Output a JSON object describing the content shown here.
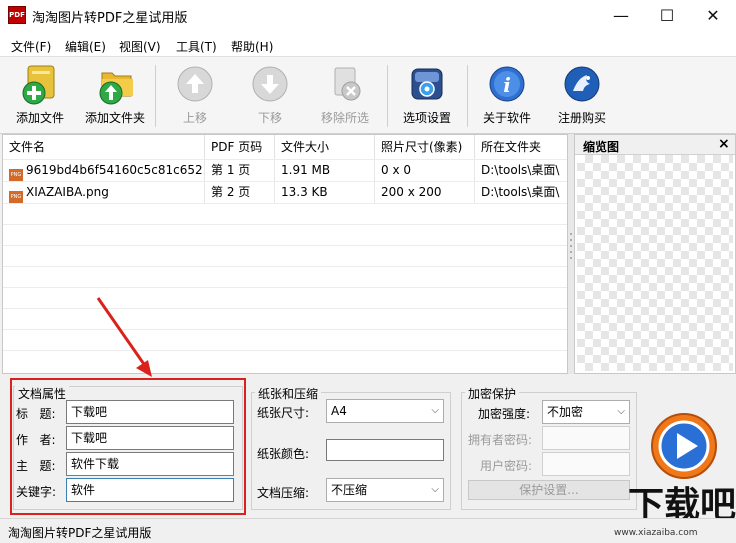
{
  "window": {
    "title": "淘淘图片转PDF之星试用版",
    "app_icon": "PDF",
    "controls": {
      "minimize": "—",
      "maximize": "☐",
      "close": "✕"
    }
  },
  "menu": [
    "文件(F)",
    "编辑(E)",
    "视图(V)",
    "工具(T)",
    "帮助(H)"
  ],
  "toolbar": [
    {
      "label": "添加文件",
      "icon": "add-file-icon",
      "enabled": true
    },
    {
      "label": "添加文件夹",
      "icon": "add-folder-icon",
      "enabled": true
    },
    {
      "label": "上移",
      "icon": "move-up-icon",
      "enabled": false
    },
    {
      "label": "下移",
      "icon": "move-down-icon",
      "enabled": false
    },
    {
      "label": "移除所选",
      "icon": "remove-selected-icon",
      "enabled": false
    },
    {
      "label": "选项设置",
      "icon": "options-icon",
      "enabled": true
    },
    {
      "label": "关于软件",
      "icon": "about-icon",
      "enabled": true
    },
    {
      "label": "注册购买",
      "icon": "register-icon",
      "enabled": true
    }
  ],
  "filelist": {
    "columns": [
      "文件名",
      "PDF 页码",
      "文件大小",
      "照片尺寸(像素)",
      "所在文件夹"
    ],
    "rows": [
      [
        "9619bd4b6f54160c5c81c652...",
        "第 1 页",
        "1.91 MB",
        "0 x 0",
        "D:\\tools\\桌面\\"
      ],
      [
        "XIAZAIBA.png",
        "第 2 页",
        "13.3 KB",
        "200 x 200",
        "D:\\tools\\桌面\\"
      ]
    ],
    "file_icon": "PNG"
  },
  "thumbnail": {
    "title": "缩览图",
    "close": "×"
  },
  "doc_props": {
    "legend": "文档属性",
    "title_label": "标   题:",
    "title_value": "下载吧",
    "author_label": "作   者:",
    "author_value": "下载吧",
    "subject_label": "主   题:",
    "subject_value": "软件下载",
    "keywords_label": "关键字:",
    "keywords_value": "软件"
  },
  "paper": {
    "legend": "纸张和压缩",
    "size_label": "纸张尺寸:",
    "size_value": "A4",
    "color_label": "纸张颜色:",
    "compress_label": "文档压缩:",
    "compress_value": "不压缩"
  },
  "encrypt": {
    "legend": "加密保护",
    "strength_label": "加密强度:",
    "strength_value": "不加密",
    "owner_label": "拥有者密码:",
    "user_label": "用户密码:",
    "protect_button": "保护设置..."
  },
  "watermark": {
    "brand": "下载吧",
    "url": "www.xiazaiba.com"
  },
  "status": "淘淘图片转PDF之星试用版",
  "colors": {
    "annotation_red": "#d9221c",
    "start_orange": "#f07818",
    "start_blue": "#2a6fd6"
  }
}
